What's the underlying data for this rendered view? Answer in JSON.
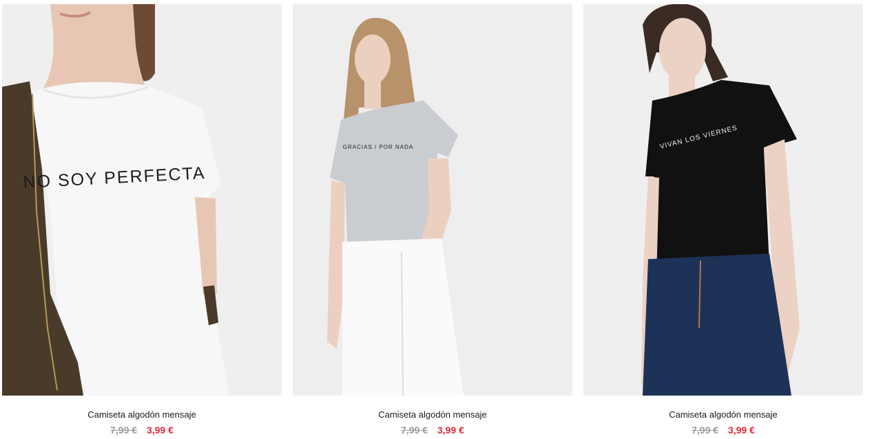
{
  "colors": {
    "sale_price": "#e0283a",
    "old_price": "#9a9a9a",
    "photo_background": "#eeeeee"
  },
  "products": [
    {
      "name": "Camiseta algodón mensaje",
      "old_price": "7,99 €",
      "price": "3,99 €",
      "print": "NO SOY PERFECTA",
      "shirt_color": "#f5f5f5"
    },
    {
      "name": "Camiseta algodón mensaje",
      "old_price": "7,99 €",
      "price": "3,99 €",
      "print": "GRACIAS / POR NADA",
      "shirt_color": "#c9ccd0"
    },
    {
      "name": "Camiseta algodón mensaje",
      "old_price": "7,99 €",
      "price": "3,99 €",
      "print": "VIVAN LOS VIERNES",
      "shirt_color": "#111111"
    }
  ]
}
